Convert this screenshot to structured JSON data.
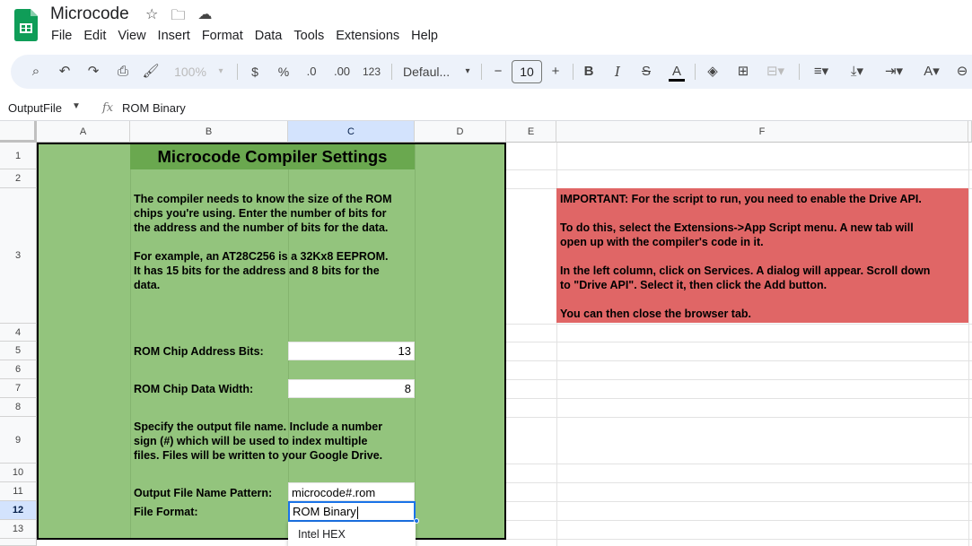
{
  "app": {
    "title": "Microcode",
    "menu": [
      "File",
      "Edit",
      "View",
      "Insert",
      "Format",
      "Data",
      "Tools",
      "Extensions",
      "Help"
    ]
  },
  "toolbar": {
    "zoom": "100%",
    "currency": "$",
    "percent": "%",
    "dec_decrease": ".0",
    "dec_increase": ".00",
    "number_format": "123",
    "font": "Defaul...",
    "font_size": "10",
    "minus": "−",
    "plus": "+",
    "bold": "B",
    "italic": "I",
    "strike": "S"
  },
  "formula_bar": {
    "name_box": "OutputFile",
    "fx": "fx",
    "content": "ROM Binary"
  },
  "columns": [
    "A",
    "B",
    "C",
    "D",
    "E",
    "F"
  ],
  "rows": [
    "1",
    "2",
    "3",
    "4",
    "5",
    "6",
    "7",
    "8",
    "9",
    "10",
    "11",
    "12",
    "13"
  ],
  "sheet": {
    "title": "Microcode Compiler Settings",
    "intro_line1": "The compiler needs to know the size of the ROM",
    "intro_line2": "chips you're using. Enter the number of bits for",
    "intro_line3": "the address and the number of bits for the data.",
    "intro_line4": "For example, an AT28C256 is a 32Kx8 EEPROM.",
    "intro_line5": "It has 15 bits for the address and 8 bits for the",
    "intro_line6": "data.",
    "address_bits_label": "ROM Chip Address Bits:",
    "address_bits_value": "13",
    "data_width_label": "ROM Chip Data Width:",
    "data_width_value": "8",
    "output_line1": "Specify the output file name. Include a number",
    "output_line2": "sign (#) which will be used to index multiple",
    "output_line3": "files. Files will be written to your Google Drive.",
    "pattern_label": "Output File Name Pattern:",
    "pattern_value": "microcode#.rom",
    "format_label": "File Format:",
    "format_value": "ROM Binary",
    "dropdown_option": "Intel HEX"
  },
  "notice": {
    "p1": "IMPORTANT: For the script to run, you need to enable the Drive API.",
    "p2_line1": "To do this, select the Extensions->App Script menu. A new tab will",
    "p2_line2": "open up with the compiler's code in it.",
    "p3_line1": "In the left column, click on Services. A dialog will appear. Scroll down",
    "p3_line2": "to \"Drive API\". Select it, then click the Add button.",
    "p4": "You can then close the browser tab."
  },
  "colors": {
    "green_bg": "#93c47d",
    "green_title": "#6aa84f",
    "red_notice": "#e06666",
    "selection_blue": "#1a73e8"
  }
}
